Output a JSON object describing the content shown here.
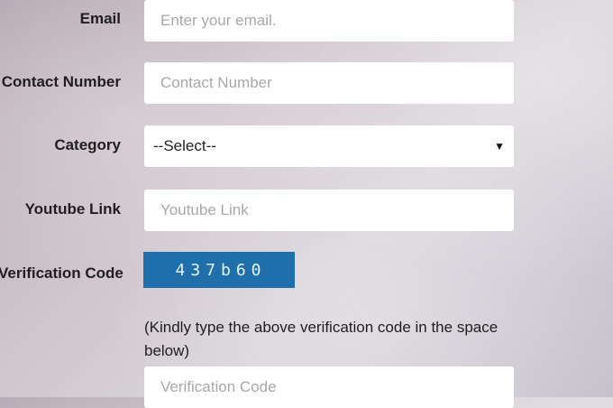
{
  "form": {
    "email": {
      "label": "Email",
      "placeholder": "Enter your email."
    },
    "contact": {
      "label": "Contact Number",
      "placeholder": "Contact Number"
    },
    "category": {
      "label": "Category",
      "selected": "--Select--"
    },
    "youtube": {
      "label": "Youtube Link",
      "placeholder": "Youtube Link"
    },
    "verification": {
      "label": "Verification Code",
      "captcha": "437b60",
      "note": "(Kindly type the above verification code in the space below)",
      "placeholder": "Verification Code"
    }
  }
}
